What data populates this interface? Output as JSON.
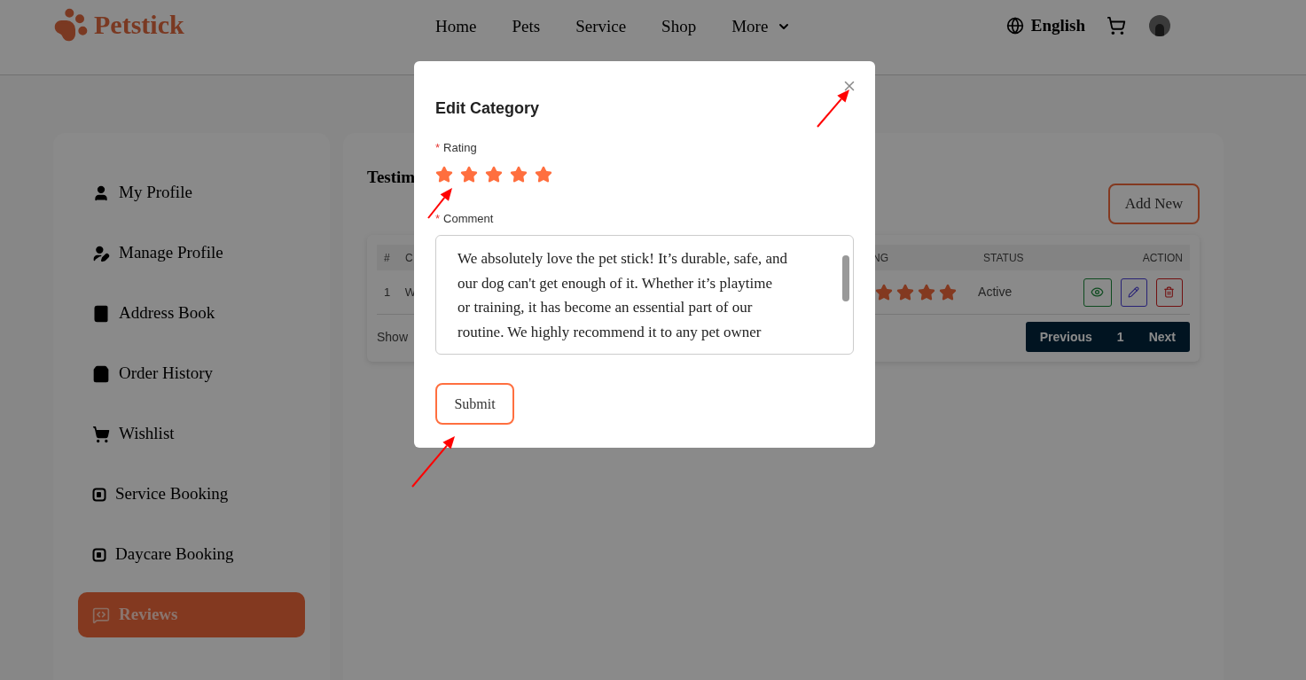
{
  "brand": "Petstick",
  "nav": [
    {
      "label": "Home",
      "has_menu": false
    },
    {
      "label": "Pets",
      "has_menu": false
    },
    {
      "label": "Service",
      "has_menu": false
    },
    {
      "label": "Shop",
      "has_menu": false
    },
    {
      "label": "More",
      "has_menu": true
    }
  ],
  "language": "English",
  "sidebar": {
    "items": [
      {
        "label": "My Profile",
        "kind": "user",
        "selected": false
      },
      {
        "label": "Manage Profile",
        "kind": "user-edit",
        "selected": false
      },
      {
        "label": "Address Book",
        "kind": "contacts",
        "selected": false
      },
      {
        "label": "Order History",
        "kind": "bag",
        "selected": false
      },
      {
        "label": "Wishlist",
        "kind": "cart",
        "selected": false
      },
      {
        "label": "Service Booking",
        "kind": "booking",
        "selected": false
      },
      {
        "label": "Daycare Booking",
        "kind": "booking",
        "selected": false
      },
      {
        "label": "Reviews",
        "kind": "reviews",
        "selected": true
      }
    ]
  },
  "main": {
    "title": "Testim",
    "add_button": "Add New",
    "table": {
      "columns": [
        "#",
        "C",
        "NG",
        "STATUS",
        "ACTION"
      ],
      "rows": [
        {
          "cells": [
            "1",
            "W"
          ],
          "stars": 4,
          "status": "Active"
        }
      ]
    },
    "show_label": "Show",
    "pagination": {
      "previous": "Previous",
      "page": "1",
      "next": "Next"
    }
  },
  "modal": {
    "title": "Edit Category",
    "rating": {
      "label": "Rating",
      "required_mark": "*",
      "stars": 5
    },
    "comment": {
      "label": "Comment",
      "required_mark": "*",
      "value_lines": [
        "We absolutely love the pet stick! It’s durable, safe, and",
        "our dog can't get enough of it. Whether it’s playtime",
        "or training, it has become an essential part of our",
        "routine. We highly recommend it to any pet owner"
      ]
    },
    "submit": "Submit"
  }
}
